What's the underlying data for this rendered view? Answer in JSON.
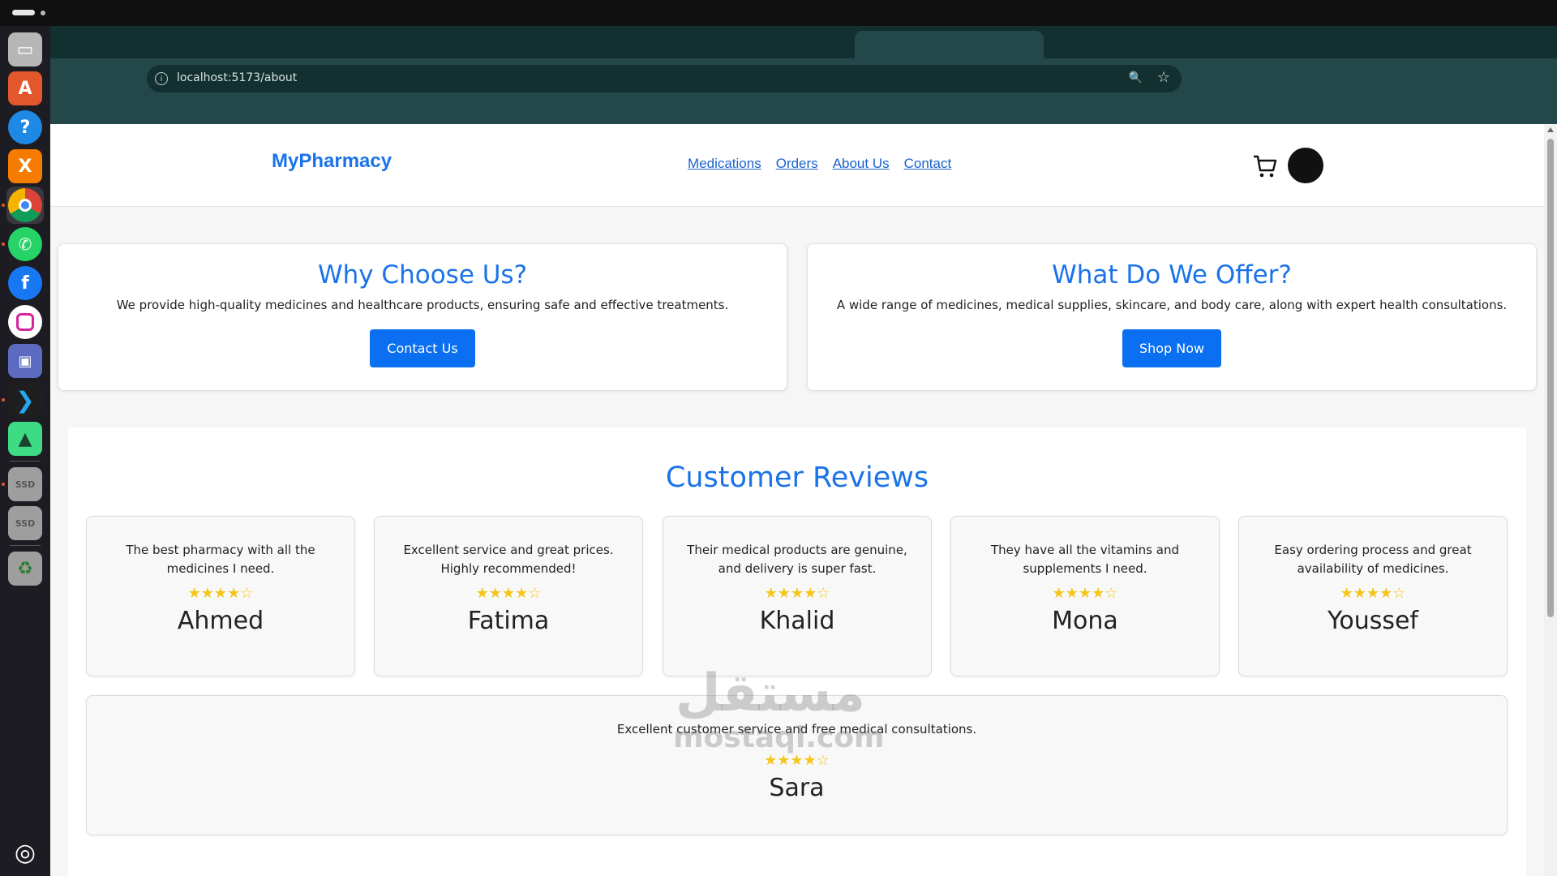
{
  "browser": {
    "url": "localhost:5173/about"
  },
  "site": {
    "brand": "MyPharmacy",
    "nav": [
      "Medications",
      "Orders",
      "About Us",
      "Contact"
    ]
  },
  "info_cards": [
    {
      "title": "Why Choose Us?",
      "text": "We provide high-quality medicines and healthcare products, ensuring safe and effective treatments.",
      "button": "Contact Us"
    },
    {
      "title": "What Do We Offer?",
      "text": "A wide range of medicines, medical supplies, skincare, and body care, along with expert health consultations.",
      "button": "Shop Now"
    }
  ],
  "reviews": {
    "title": "Customer Reviews",
    "items": [
      {
        "text": "The best pharmacy with all the medicines I need.",
        "stars": "★★★★☆",
        "name": "Ahmed"
      },
      {
        "text": "Excellent service and great prices. Highly recommended!",
        "stars": "★★★★☆",
        "name": "Fatima"
      },
      {
        "text": "Their medical products are genuine, and delivery is super fast.",
        "stars": "★★★★☆",
        "name": "Khalid"
      },
      {
        "text": "They have all the vitamins and supplements I need.",
        "stars": "★★★★☆",
        "name": "Mona"
      },
      {
        "text": "Easy ordering process and great availability of medicines.",
        "stars": "★★★★☆",
        "name": "Youssef"
      },
      {
        "text": "Excellent customer service and free medical consultations.",
        "stars": "★★★★☆",
        "name": "Sara"
      }
    ]
  },
  "watermark": {
    "arabic": "مستقل",
    "latin": "mostaql.com"
  },
  "colors": {
    "accent": "#1a73e8",
    "button": "#0a6ff0",
    "star": "#f5c518",
    "browser_frame": "#24484a"
  }
}
